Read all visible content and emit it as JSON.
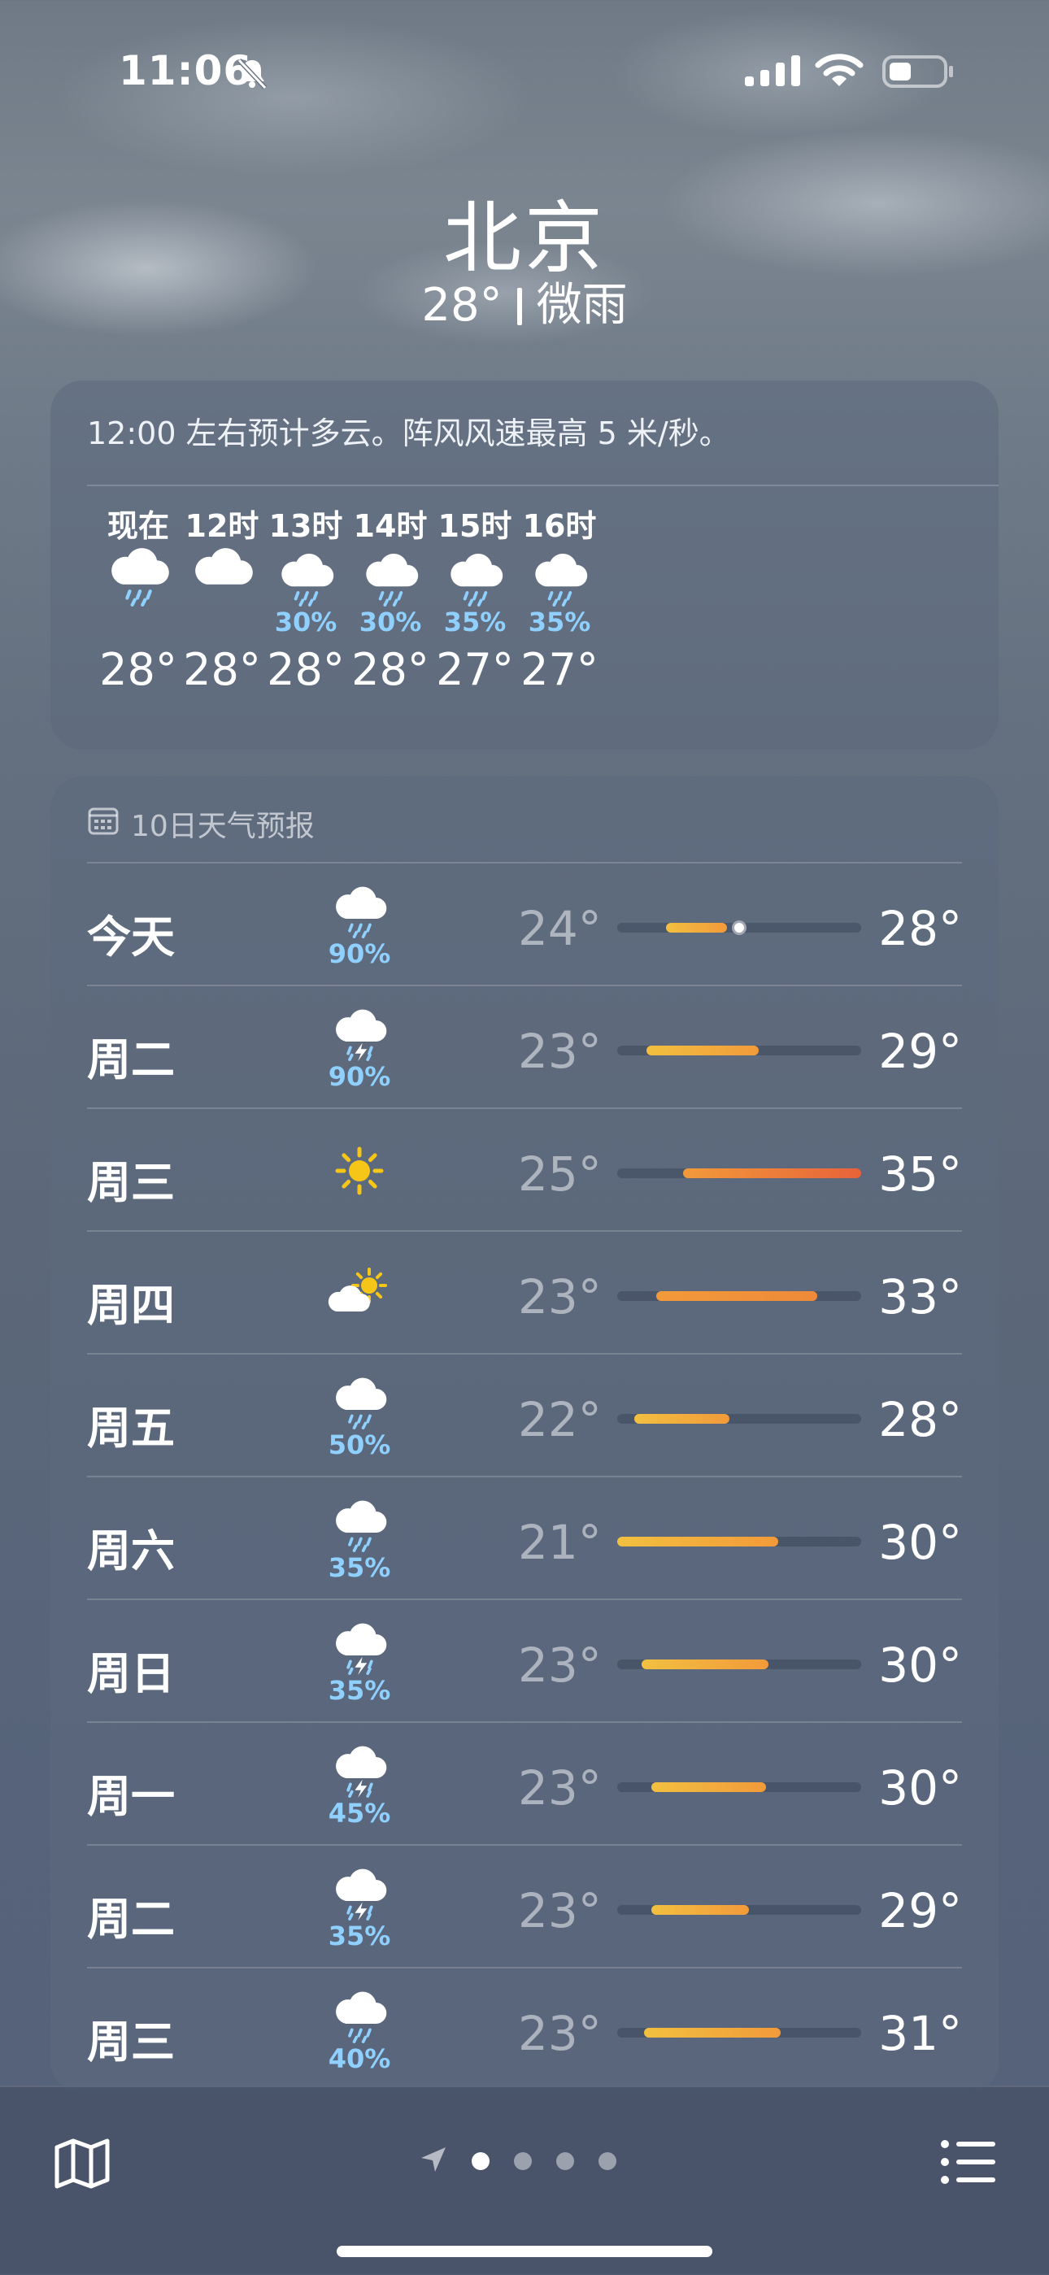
{
  "status_bar": {
    "time": "11:06"
  },
  "location": {
    "city": "北京",
    "current_temp": "28°",
    "condition": "微雨"
  },
  "hourly": {
    "summary": "12:00 左右预计多云。阵风风速最高 5 米/秒。",
    "items": [
      {
        "label": "现在",
        "icon": "rain-cloud-icon",
        "precip": "",
        "temp": "28°"
      },
      {
        "label": "12时",
        "icon": "cloud-icon",
        "precip": "",
        "temp": "28°"
      },
      {
        "label": "13时",
        "icon": "rain-cloud-icon",
        "precip": "30%",
        "temp": "28°"
      },
      {
        "label": "14时",
        "icon": "rain-cloud-icon",
        "precip": "30%",
        "temp": "28°"
      },
      {
        "label": "15时",
        "icon": "rain-cloud-icon",
        "precip": "35%",
        "temp": "27°"
      },
      {
        "label": "16时",
        "icon": "rain-cloud-icon",
        "precip": "35%",
        "temp": "27°"
      }
    ]
  },
  "daily": {
    "header": "10日天气预报",
    "days": [
      {
        "day": "今天",
        "icon": "rain-cloud-icon",
        "precip": "90%",
        "low": "24°",
        "high": "28°",
        "bar_start": 0.2,
        "bar_end": 0.45,
        "current_marker": 0.5
      },
      {
        "day": "周二",
        "icon": "thunderstorm-icon",
        "precip": "90%",
        "low": "23°",
        "high": "29°",
        "bar_start": 0.12,
        "bar_end": 0.58
      },
      {
        "day": "周三",
        "icon": "sun-icon",
        "precip": "",
        "low": "25°",
        "high": "35°",
        "bar_start": 0.27,
        "bar_end": 1.0
      },
      {
        "day": "周四",
        "icon": "partly-cloudy-icon",
        "precip": "",
        "low": "23°",
        "high": "33°",
        "bar_start": 0.16,
        "bar_end": 0.82
      },
      {
        "day": "周五",
        "icon": "rain-cloud-icon",
        "precip": "50%",
        "low": "22°",
        "high": "28°",
        "bar_start": 0.07,
        "bar_end": 0.46
      },
      {
        "day": "周六",
        "icon": "rain-cloud-icon",
        "precip": "35%",
        "low": "21°",
        "high": "30°",
        "bar_start": 0.0,
        "bar_end": 0.66
      },
      {
        "day": "周日",
        "icon": "thunderstorm-icon",
        "precip": "35%",
        "low": "23°",
        "high": "30°",
        "bar_start": 0.1,
        "bar_end": 0.62
      },
      {
        "day": "周一",
        "icon": "thunderstorm-icon",
        "precip": "45%",
        "low": "23°",
        "high": "30°",
        "bar_start": 0.14,
        "bar_end": 0.61
      },
      {
        "day": "周二",
        "icon": "thunderstorm-icon",
        "precip": "35%",
        "low": "23°",
        "high": "29°",
        "bar_start": 0.14,
        "bar_end": 0.54
      },
      {
        "day": "周三",
        "icon": "rain-cloud-icon",
        "precip": "40%",
        "low": "23°",
        "high": "31°",
        "bar_start": 0.11,
        "bar_end": 0.67
      }
    ]
  },
  "bottom_bar": {
    "map_icon": "map-icon",
    "location_arrow_icon": "location-arrow-icon",
    "page_count": 4,
    "active_page": 0,
    "list_icon": "list-icon"
  },
  "colors": {
    "precip_blue": "#8fd0ff",
    "bar_yellow": "#f2c040",
    "bar_orange": "#f29a3a",
    "bar_red": "#e8623a"
  }
}
